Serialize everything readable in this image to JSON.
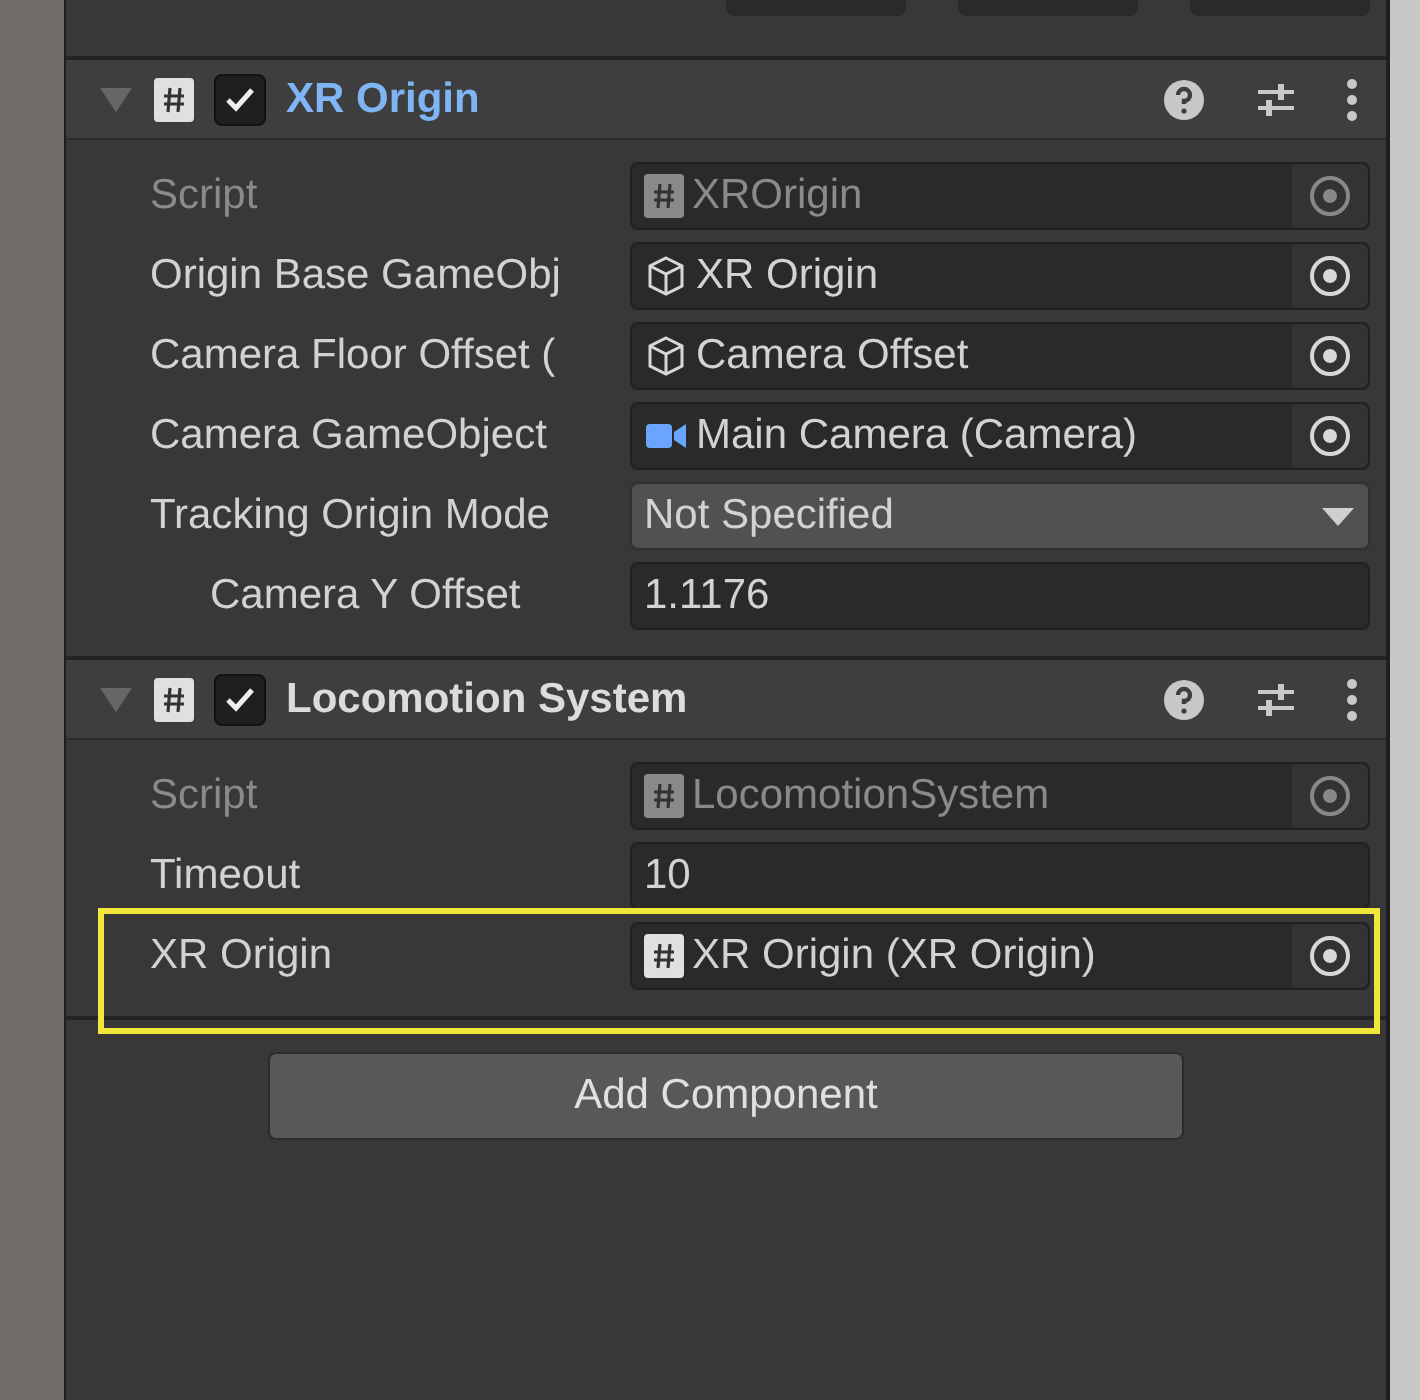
{
  "components": [
    {
      "title": "XR Origin",
      "expanded": true,
      "enabled": true,
      "highlighted": true,
      "fields": [
        {
          "label": "Script",
          "kind": "script",
          "value": "XROrigin",
          "disabled": true
        },
        {
          "label": "Origin Base GameObj",
          "kind": "gameobject",
          "value": "XR Origin",
          "disabled": false
        },
        {
          "label": "Camera Floor Offset (",
          "kind": "gameobject",
          "value": "Camera Offset",
          "disabled": false
        },
        {
          "label": "Camera GameObject",
          "kind": "camera",
          "value": "Main Camera (Camera)",
          "disabled": false
        },
        {
          "label": "Tracking Origin Mode",
          "kind": "dropdown",
          "value": "Not Specified",
          "disabled": false,
          "children": [
            {
              "label": "Camera Y Offset",
              "kind": "number",
              "value": "1.1176",
              "disabled": false
            }
          ]
        }
      ]
    },
    {
      "title": "Locomotion System",
      "expanded": true,
      "enabled": true,
      "highlighted": false,
      "fields": [
        {
          "label": "Script",
          "kind": "script",
          "value": "LocomotionSystem",
          "disabled": true
        },
        {
          "label": "Timeout",
          "kind": "number",
          "value": "10",
          "disabled": false
        },
        {
          "label": "XR Origin",
          "kind": "script",
          "value": "XR Origin (XR Origin)",
          "disabled": false,
          "outlined": true
        }
      ]
    }
  ],
  "add_button": "Add Component"
}
